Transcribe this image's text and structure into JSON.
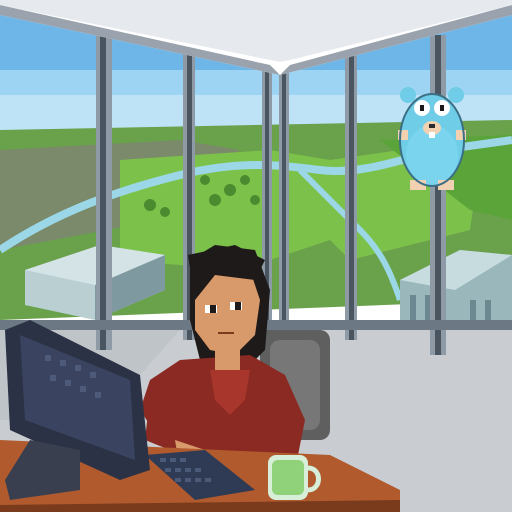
{
  "scene": {
    "title": "",
    "palette": {
      "sky_top": "#6fb6e8",
      "sky_mid": "#9dd3f3",
      "grass": "#7cc24a",
      "grass_dark": "#5aa43a",
      "river": "#9bd7e6",
      "building": "#b9cfd2",
      "building_dark": "#7e9aa0",
      "mullion": "#8e9aa6",
      "mullion_dark": "#4a5560",
      "ceiling": "#ffffff",
      "floor": "#c9cdd1",
      "desk": "#b05a2e",
      "desk_edge": "#7a3a1c",
      "monitor": "#2b3245",
      "keyboard": "#2f3a55",
      "shirt": "#8a2a22",
      "skin": "#d89a6a",
      "hair": "#1f1a1a",
      "chair": "#6b6b6b",
      "gopher": "#6fcde8",
      "gopher_dark": "#3b6f86",
      "mug": "#d7eed8",
      "tea": "#8fd27a"
    },
    "icons": [
      "gopher-mascot-icon"
    ]
  }
}
